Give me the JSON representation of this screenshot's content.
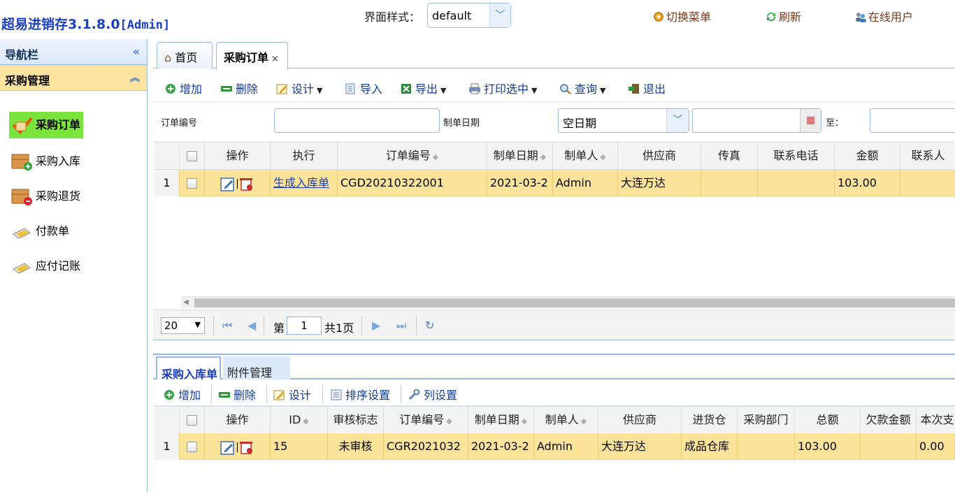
{
  "header": {
    "app_title": "超易进销存3.1.8.0",
    "app_user": "[Admin]",
    "theme_label": "界面样式：",
    "theme_value": "default",
    "switch_menu": "切换菜单",
    "refresh": "刷新",
    "online_users": "在线用户"
  },
  "nav": {
    "title": "导航栏",
    "collapse_icon": "«",
    "section": "采购管理",
    "section_icon": "︽",
    "items": [
      {
        "label": "采购订单",
        "icon": "order-icon",
        "active": true
      },
      {
        "label": "采购入库",
        "icon": "box-add-icon"
      },
      {
        "label": "采购退货",
        "icon": "box-remove-icon"
      },
      {
        "label": "付款单",
        "icon": "payment-icon"
      },
      {
        "label": "应付记账",
        "icon": "ledger-icon"
      }
    ]
  },
  "tabs": [
    {
      "label": "首页",
      "icon": "home-icon"
    },
    {
      "label": "采购订单",
      "close": "×",
      "selected": true
    }
  ],
  "toolbar": {
    "add": "增加",
    "delete": "删除",
    "design": "设计",
    "import": "导入",
    "export": "导出",
    "print": "打印选中",
    "query": "查询",
    "exit": "退出",
    "dropdown": "▼"
  },
  "search": {
    "order_no_label": "订单编号",
    "date_label": "制单日期",
    "date_option": "空日期",
    "to_label": "至："
  },
  "grid1": {
    "columns": [
      "操作",
      "执行",
      "订单编号",
      "制单日期",
      "制单人",
      "供应商",
      "传真",
      "联系电话",
      "金额",
      "联系人"
    ],
    "rows": [
      {
        "num": "1",
        "exec": "生成入库单",
        "order_no": "CGD20210322001",
        "date": "2021-03-2",
        "maker": "Admin",
        "supplier": "大连万达",
        "fax": "",
        "phone": "",
        "amount": "103.00",
        "contact": ""
      }
    ]
  },
  "pager": {
    "page_size": "20",
    "page_prefix": "第",
    "page_no": "1",
    "page_total": "共1页"
  },
  "bottom_tabs": [
    "采购入库单",
    "附件管理"
  ],
  "toolbar2": {
    "add": "增加",
    "delete": "删除",
    "design": "设计",
    "sort": "排序设置",
    "columns": "列设置"
  },
  "grid2": {
    "columns": [
      "操作",
      "ID",
      "审核标志",
      "订单编号",
      "制单日期",
      "制单人",
      "供应商",
      "进货仓",
      "采购部门",
      "总额",
      "欠款金额",
      "本次支"
    ],
    "rows": [
      {
        "num": "1",
        "id": "15",
        "audit": "未审核",
        "order_no": "CGR2021032",
        "date": "2021-03-2",
        "maker": "Admin",
        "supplier": "大连万达",
        "warehouse": "成品仓库",
        "dept": "",
        "total": "103.00",
        "owed": "",
        "paid": "0.00"
      }
    ]
  }
}
